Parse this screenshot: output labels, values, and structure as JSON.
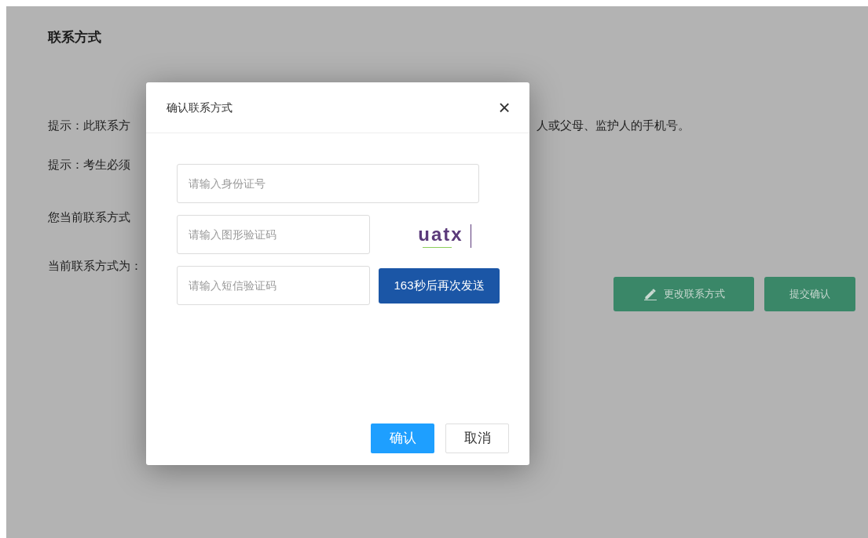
{
  "page": {
    "title": "联系方式",
    "lines": [
      {
        "left": "提示：此联系方",
        "right": "人或父母、监护人的手机号。"
      },
      {
        "left": "提示：考生必须"
      },
      {
        "left": "您当前联系方式"
      },
      {
        "left": "当前联系方式为："
      }
    ],
    "buttons": [
      {
        "label": "更改联系方式",
        "kind": "edit"
      },
      {
        "label": "提交确认",
        "kind": "plain"
      }
    ]
  },
  "dialog": {
    "title": "确认联系方式",
    "close": "×",
    "id_field": {
      "placeholder": "请输入身份证号"
    },
    "captcha_field": {
      "placeholder": "请输入图形验证码"
    },
    "captcha_image": "uatx",
    "sms_field": {
      "placeholder": "请输入短信验证码"
    },
    "send_button": {
      "label": "163秒后再次发送",
      "disabled": true
    },
    "buttons": [
      {
        "label": "确认",
        "kind": "primary"
      },
      {
        "label": "取消",
        "kind": "default"
      }
    ]
  }
}
